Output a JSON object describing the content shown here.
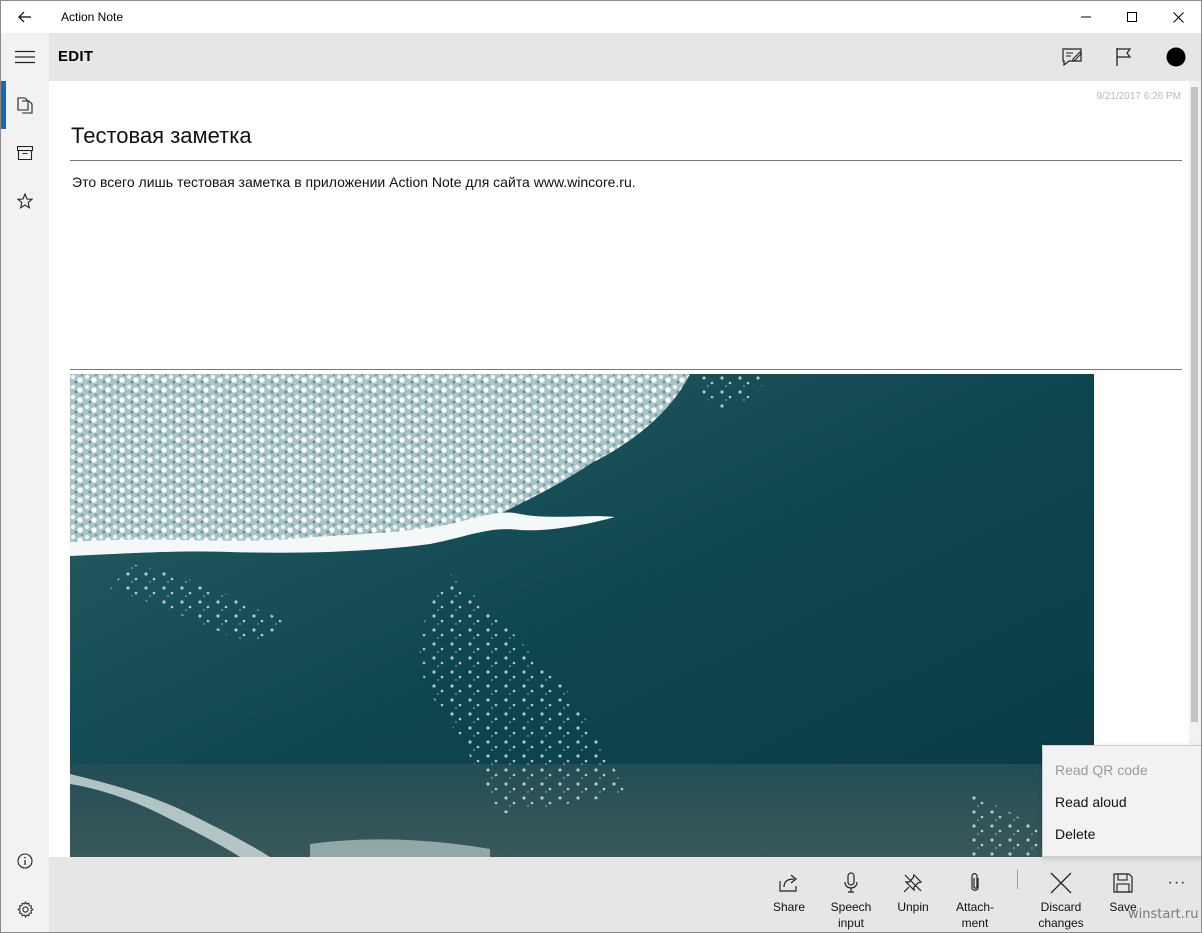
{
  "window": {
    "title": "Action Note"
  },
  "header": {
    "title": "EDIT"
  },
  "note": {
    "timestamp": "9/21/2017 6:26 PM",
    "title": "Тестовая заметка",
    "body": "Это всего лишь тестовая заметка в приложении Action Note для сайта www.wincore.ru."
  },
  "commands": {
    "share": "Share",
    "speech_1": "Speech",
    "speech_2": "input",
    "unpin": "Unpin",
    "attach_1": "Attach-",
    "attach_2": "ment",
    "discard_1": "Discard",
    "discard_2": "changes",
    "save": "Save",
    "more": "···"
  },
  "flyout": {
    "read_qr": "Read QR code",
    "read_aloud": "Read aloud",
    "delete": "Delete"
  },
  "watermark": "winstart.ru",
  "colors": {
    "accent": "#1a64b4",
    "nav_bg": "#f2f2f2",
    "bar_bg": "#e6e6e6",
    "sea_dark": "#0f4650"
  }
}
